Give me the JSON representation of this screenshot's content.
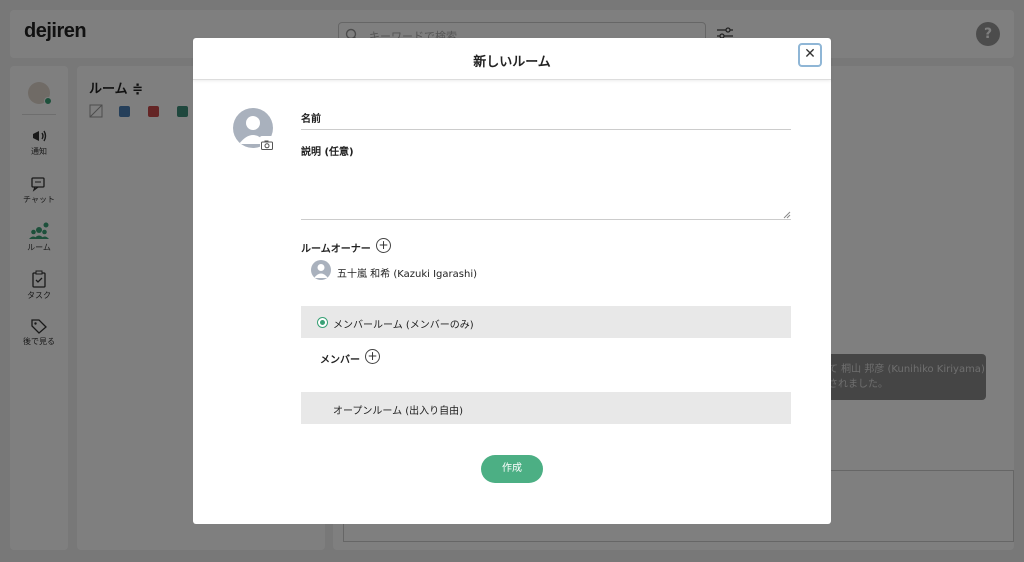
{
  "app": {
    "logo": "dejiren",
    "search_placeholder": "キーワードで検索",
    "help_label": "?"
  },
  "nav": {
    "items": [
      {
        "label": "通知",
        "icon": "megaphone-icon"
      },
      {
        "label": "チャット",
        "icon": "chat-icon"
      },
      {
        "label": "ルーム",
        "icon": "group-icon"
      },
      {
        "label": "タスク",
        "icon": "clipboard-icon"
      },
      {
        "label": "後で見る",
        "icon": "tag-icon"
      }
    ]
  },
  "room_panel": {
    "title": "ルーム ≑",
    "chip_colors": [
      "#4a7fb5",
      "#c94a4a",
      "#3e8f7a"
    ]
  },
  "toast": {
    "line1": "て 桐山 邦彦 (Kunihiko Kiriyama)",
    "line2": "されました。"
  },
  "modal": {
    "title": "新しいルーム",
    "close_label": "✕",
    "name_label": "名前",
    "description_label": "説明 (任意)",
    "owner_label": "ルームオーナー",
    "owner_name": "五十嵐 和希 (Kazuki Igarashi)",
    "member_room_option": "メンバールーム (メンバーのみ)",
    "member_label": "メンバー",
    "open_room_option": "オープンルーム (出入り自由)",
    "create_button": "作成",
    "plus_label": "+"
  },
  "colors": {
    "accent": "#4caf84",
    "radio": "#3aa176"
  }
}
